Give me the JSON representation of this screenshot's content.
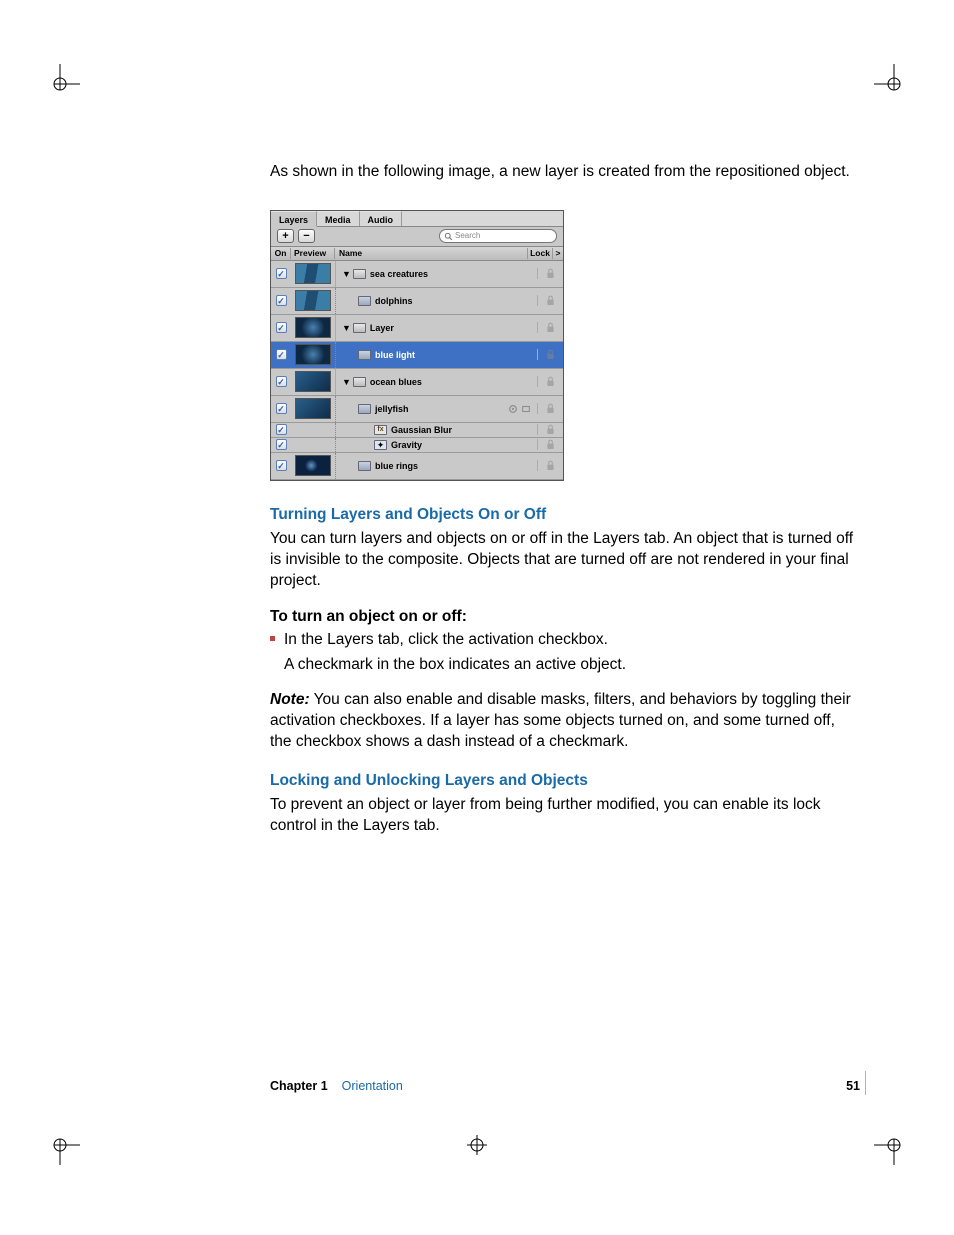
{
  "intro": "As shown in the following image, a new layer is created from the repositioned object.",
  "panel": {
    "tabs": [
      "Layers",
      "Media",
      "Audio"
    ],
    "activeTab": 0,
    "addLabel": "+",
    "removeLabel": "−",
    "searchPlaceholder": "Search",
    "columns": {
      "on": "On",
      "preview": "Preview",
      "name": "Name",
      "lock": "Lock",
      "more": ">"
    },
    "rows": [
      {
        "name": "sea creatures",
        "kind": "group",
        "indent": 0,
        "thumb": "t1",
        "selected": false,
        "short": false,
        "badges": []
      },
      {
        "name": "dolphins",
        "kind": "image",
        "indent": 1,
        "thumb": "t1",
        "selected": false,
        "short": false,
        "badges": []
      },
      {
        "name": "Layer",
        "kind": "group",
        "indent": 0,
        "thumb": "t2",
        "selected": false,
        "short": false,
        "badges": []
      },
      {
        "name": "blue light",
        "kind": "image",
        "indent": 1,
        "thumb": "t2",
        "selected": true,
        "short": false,
        "badges": []
      },
      {
        "name": "ocean blues",
        "kind": "group",
        "indent": 0,
        "thumb": "t3",
        "selected": false,
        "short": false,
        "badges": []
      },
      {
        "name": "jellyfish",
        "kind": "image",
        "indent": 1,
        "thumb": "t3",
        "selected": false,
        "short": false,
        "badges": [
          "gear",
          "clip"
        ]
      },
      {
        "name": "Gaussian Blur",
        "kind": "filter",
        "indent": 2,
        "thumb": "",
        "selected": false,
        "short": true,
        "badges": []
      },
      {
        "name": "Gravity",
        "kind": "behav",
        "indent": 2,
        "thumb": "",
        "selected": false,
        "short": true,
        "badges": []
      },
      {
        "name": "blue rings",
        "kind": "image",
        "indent": 1,
        "thumb": "t4",
        "selected": false,
        "short": false,
        "badges": []
      }
    ]
  },
  "section1": {
    "title": "Turning Layers and Objects On or Off",
    "body": "You can turn layers and objects on or off in the Layers tab. An object that is turned off is invisible to the composite. Objects that are turned off are not rendered in your final project.",
    "subhead": "To turn an object on or off:",
    "step": "In the Layers tab, click the activation checkbox.",
    "stepFollow": "A checkmark in the box indicates an active object.",
    "noteLabel": "Note:",
    "noteBody": "You can also enable and disable masks, filters, and behaviors by toggling their activation checkboxes. If a layer has some objects turned on, and some turned off, the checkbox shows a dash instead of a checkmark."
  },
  "section2": {
    "title": "Locking and Unlocking Layers and Objects",
    "body": "To prevent an object or layer from being further modified, you can enable its lock control in the Layers tab."
  },
  "footer": {
    "chapterLabel": "Chapter 1",
    "chapterName": "Orientation",
    "pageNumber": "51"
  }
}
